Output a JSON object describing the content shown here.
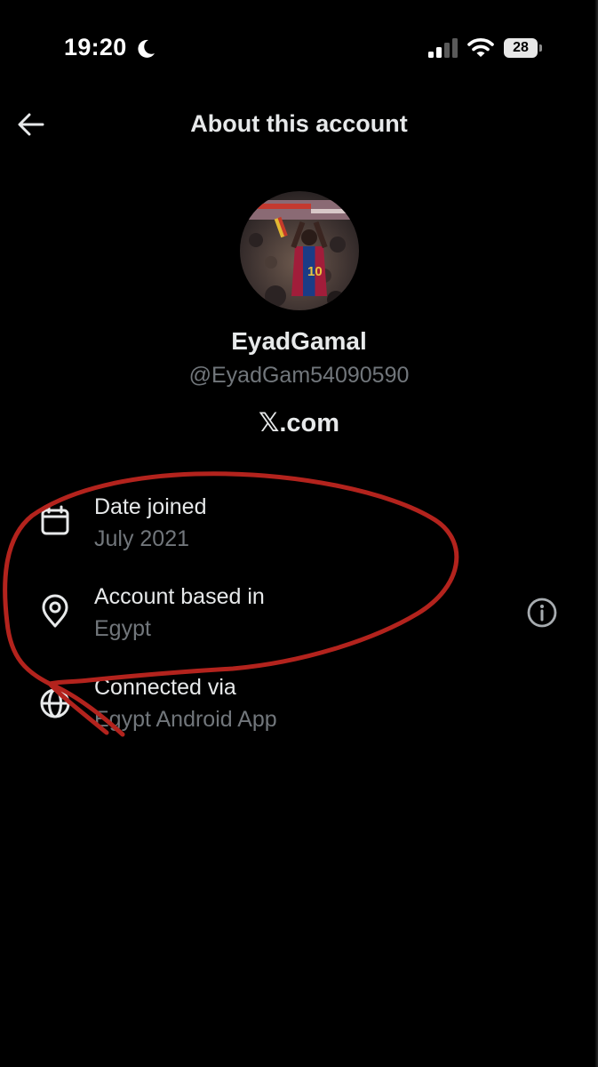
{
  "status_bar": {
    "time": "19:20",
    "battery_level": "28",
    "icons": [
      "moon-icon",
      "cellular-signal-icon",
      "wifi-icon",
      "battery-icon"
    ]
  },
  "header": {
    "title": "About this account",
    "back_icon": "arrow-left-icon"
  },
  "profile": {
    "display_name": "EyadGamal",
    "handle": "@EyadGam54090590",
    "site": "𝕏.com"
  },
  "details": [
    {
      "icon": "calendar-icon",
      "title": "Date joined",
      "value": "July 2021"
    },
    {
      "icon": "location-pin-icon",
      "title": "Account based in",
      "value": "Egypt",
      "trailing_icon": "info-icon"
    },
    {
      "icon": "globe-icon",
      "title": "Connected via",
      "value": "Egypt Android App"
    }
  ],
  "colors": {
    "background": "#000000",
    "primary_text": "#e7e9ea",
    "secondary_text": "#71767b",
    "annotation_stroke": "#b3231d"
  }
}
